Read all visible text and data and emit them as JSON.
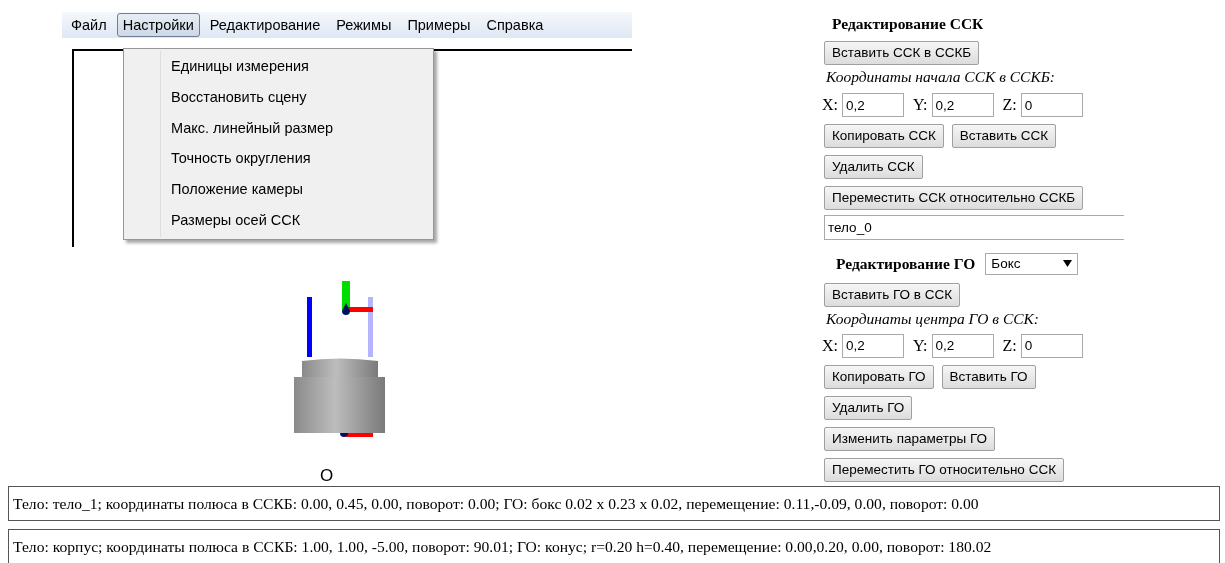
{
  "menubar": {
    "items": [
      {
        "label": "Файл",
        "selected": false
      },
      {
        "label": "Настройки",
        "selected": true
      },
      {
        "label": "Редактирование",
        "selected": false
      },
      {
        "label": "Режимы",
        "selected": false
      },
      {
        "label": "Примеры",
        "selected": false
      },
      {
        "label": "Справка",
        "selected": false
      }
    ]
  },
  "dropdown": {
    "items": [
      "Единицы измерения",
      "Восстановить сцену",
      "Макс. линейный размер",
      "Точность округления",
      "Положение камеры",
      "Размеры осей ССК"
    ]
  },
  "scene": {
    "origin_label": "O"
  },
  "ssk_panel": {
    "title": "Редактирование ССК",
    "insert_button": "Вставить ССК в ССКБ",
    "coords_label": "Координаты начала ССК в ССКБ:",
    "fields": [
      {
        "label": "X:",
        "value": "0,2"
      },
      {
        "label": "Y:",
        "value": "0,2"
      },
      {
        "label": "Z:",
        "value": "0"
      }
    ],
    "button_rows": [
      [
        "Копировать ССК",
        "Вставить ССК"
      ],
      [
        "Удалить ССК"
      ],
      [
        "Переместить ССК относительно ССКБ"
      ]
    ],
    "name_field": "тело_0"
  },
  "go_panel": {
    "title": "Редактирование ГО",
    "shape_select": "Бокс",
    "insert_button": "Вставить ГО в ССК",
    "coords_label": "Координаты центра ГО в ССК:",
    "fields": [
      {
        "label": "X:",
        "value": "0,2"
      },
      {
        "label": "Y:",
        "value": "0,2"
      },
      {
        "label": "Z:",
        "value": "0"
      }
    ],
    "button_rows": [
      [
        "Копировать ГО",
        "Вставить ГО"
      ],
      [
        "Удалить ГО"
      ],
      [
        "Изменить параметры ГО"
      ],
      [
        "Переместить ГО относительно ССК"
      ]
    ]
  },
  "status_lines": [
    "Тело: тело_1; координаты полюса в ССКБ: 0.00, 0.45, 0.00, поворот: 0.00; ГО: бокс 0.02 x 0.23 x 0.02, перемещение: 0.11,-0.09, 0.00, поворот: 0.00",
    "Тело: корпус; координаты полюса в ССКБ: 1.00, 1.00, -5.00, поворот: 90.01; ГО: конус; r=0.20 h=0.40, перемещение: 0.00,0.20, 0.00, поворот: 180.02"
  ]
}
